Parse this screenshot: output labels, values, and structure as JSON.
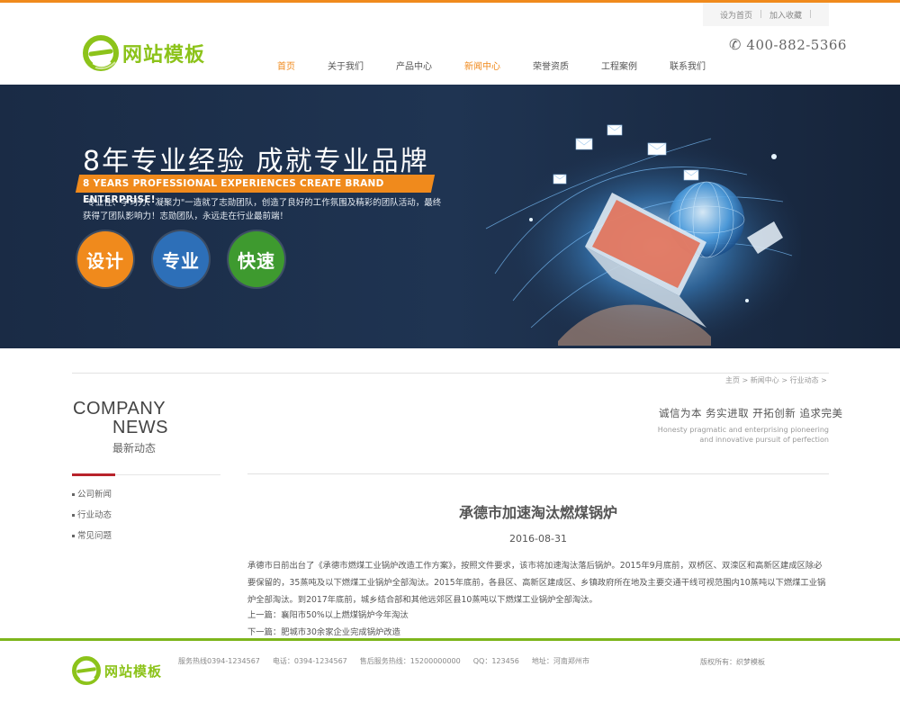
{
  "header": {
    "logo_text": "网站模板",
    "toplinks": [
      "设为首页",
      "加入收藏"
    ],
    "phone": "400-882-5366",
    "nav": [
      {
        "label": "首页",
        "active": true
      },
      {
        "label": "关于我们",
        "active": false
      },
      {
        "label": "产品中心",
        "active": false
      },
      {
        "label": "新闻中心",
        "active": true
      },
      {
        "label": "荣誉资质",
        "active": false
      },
      {
        "label": "工程案例",
        "active": false
      },
      {
        "label": "联系我们",
        "active": false
      }
    ]
  },
  "banner": {
    "title": "8年专业经验 成就专业品牌",
    "ribbon": "8 YEARS PROFESSIONAL EXPERIENCES CREATE BRAND ENTERPRISE!",
    "desc": "\"专业性、学习力、凝聚力\"一造就了志勋团队，创造了良好的工作氛围及精彩的团队活动，最终获得了团队影响力！志勋团队，永远走在行业最前端！",
    "circles": [
      "设计",
      "专业",
      "快速"
    ],
    "colors": {
      "orange": "#f08a1c",
      "blue": "#2d6fb8",
      "green": "#3e9a2f"
    }
  },
  "breadcrumb": "主页 > 新闻中心 > 行业动态 >",
  "sidebar": {
    "title_line1": "COMPANY",
    "title_line2": "NEWS",
    "title_cn": "最新动态",
    "items": [
      {
        "label": "公司新闻"
      },
      {
        "label": "行业动态"
      },
      {
        "label": "常见问题"
      }
    ]
  },
  "slogan": {
    "cn": "诚信为本 务实进取 开拓创新 追求完美",
    "en_line1": "Honesty pragmatic and enterprising pioneering",
    "en_line2": "and innovative pursuit of perfection"
  },
  "article": {
    "title": "承德市加速淘汰燃煤锅炉",
    "date": "2016-08-31",
    "body": "承德市日前出台了《承德市燃煤工业锅炉改造工作方案》，按照文件要求，该市将加速淘汰落后锅炉。2015年9月底前，双桥区、双滦区和高新区建成区除必要保留的，35蒸吨及以下燃煤工业锅炉全部淘汰。2015年底前，各县区、高新区建成区、乡镇政府所在地及主要交通干线可视范围内10蒸吨以下燃煤工业锅炉全部淘汰。到2017年底前，城乡结合部和其他远郊区县10蒸吨以下燃煤工业锅炉全部淘汰。",
    "prev": "上一篇：襄阳市50%以上燃煤锅炉今年淘汰",
    "next": "下一篇：肥城市30余家企业完成锅炉改造"
  },
  "footer": {
    "logo_text": "网站模板",
    "info": [
      "服务热线0394-1234567",
      "电话：0394-1234567",
      "售后服务热线：15200000000",
      "QQ：123456",
      "地址：河南郑州市"
    ],
    "copyright": "版权所有：织梦模板",
    "accent": "#7db51c"
  }
}
